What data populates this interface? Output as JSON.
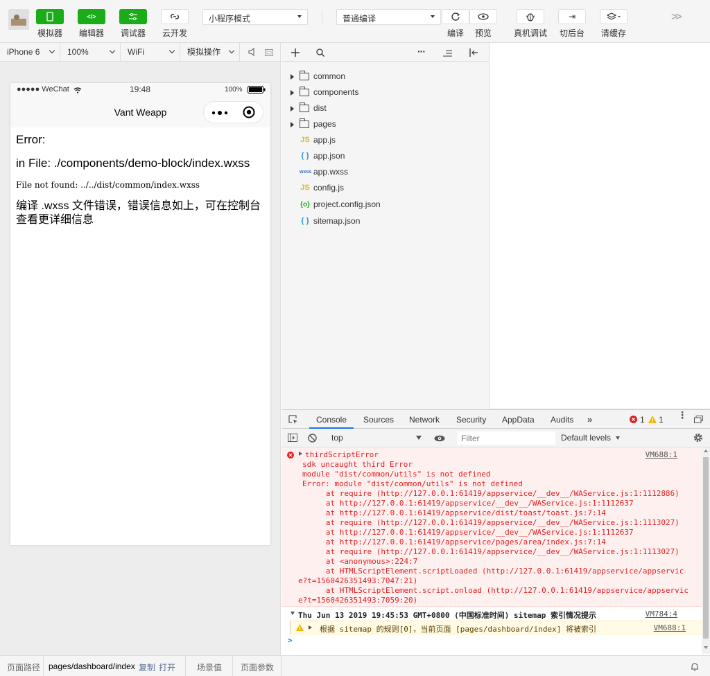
{
  "toolbar": {
    "simulator": "模拟器",
    "editor": "编辑器",
    "debugger": "调试器",
    "cloud": "云开发",
    "mode_select": "小程序模式",
    "compile_select": "普通编译",
    "compile": "编译",
    "preview": "预览",
    "remote_debug": "真机调试",
    "background": "切后台",
    "clear_cache": "清缓存"
  },
  "sim_bar": {
    "device": "iPhone 6",
    "zoom": "100%",
    "network": "WiFi",
    "operation": "模拟操作"
  },
  "phone": {
    "carrier": "●●●●● WeChat",
    "time": "19:48",
    "battery": "100%",
    "title": "Vant Weapp",
    "error_title": "Error:",
    "error_file": "in File: ./components/demo-block/index.wxss",
    "error_detail": "File not found: ../../dist/common/index.wxss",
    "error_hint": "编译 .wxss 文件错误，错误信息如上，可在控制台查看更详细信息"
  },
  "tree": {
    "items": [
      {
        "name": "common",
        "type": "folder"
      },
      {
        "name": "components",
        "type": "folder"
      },
      {
        "name": "dist",
        "type": "folder"
      },
      {
        "name": "pages",
        "type": "folder"
      },
      {
        "name": "app.js",
        "type": "js"
      },
      {
        "name": "app.json",
        "type": "json"
      },
      {
        "name": "app.wxss",
        "type": "wxss"
      },
      {
        "name": "config.js",
        "type": "js"
      },
      {
        "name": "project.config.json",
        "type": "config"
      },
      {
        "name": "sitemap.json",
        "type": "json"
      }
    ]
  },
  "devtools": {
    "tabs": [
      "Console",
      "Sources",
      "Network",
      "Security",
      "AppData",
      "Audits"
    ],
    "error_count": "1",
    "warn_count": "1",
    "context": "top",
    "filter_placeholder": "Filter",
    "levels": "Default levels",
    "console": {
      "err_vm": "VM688:1",
      "err_lines": [
        "thirdScriptError",
        "sdk uncaught third Error",
        "module \"dist/common/utils\" is not defined",
        "Error: module \"dist/common/utils\" is not defined",
        "   at require (http://127.0.0.1:61419/appservice/__dev__/WAService.js:1:1112886)",
        "   at http://127.0.0.1:61419/appservice/__dev__/WAService.js:1:1112637",
        "   at http://127.0.0.1:61419/appservice/dist/toast/toast.js:7:14",
        "   at require (http://127.0.0.1:61419/appservice/__dev__/WAService.js:1:1113027)",
        "   at http://127.0.0.1:61419/appservice/__dev__/WAService.js:1:1112637",
        "   at http://127.0.0.1:61419/appservice/pages/area/index.js:7:14",
        "   at require (http://127.0.0.1:61419/appservice/__dev__/WAService.js:1:1113027)",
        "   at <anonymous>:224:7",
        "   at HTMLScriptElement.scriptLoaded (http://127.0.0.1:61419/appservice/appservic",
        "e?t=1560426351493:7047:21)",
        "   at HTMLScriptElement.script.onload (http://127.0.0.1:61419/appservice/appservic",
        "e?t=1560426351493:7059:20)"
      ],
      "group_text": "Thu Jun 13 2019 19:45:53 GMT+0800 (中国标准时间) sitemap 索引情况提示",
      "group_vm": "VM784:4",
      "warn_text": "根据 sitemap 的规则[0]，当前页面 [pages/dashboard/index] 将被索引",
      "warn_vm": "VM688:1",
      "prompt": ">"
    }
  },
  "bottom": {
    "path_label": "页面路径",
    "path": "pages/dashboard/index",
    "copy": "复制",
    "open": "打开",
    "scene": "场景值",
    "params": "页面参数"
  },
  "colors": {
    "accent": "#1aad19",
    "error": "#e02020",
    "tab_active": "#1a73e8"
  }
}
